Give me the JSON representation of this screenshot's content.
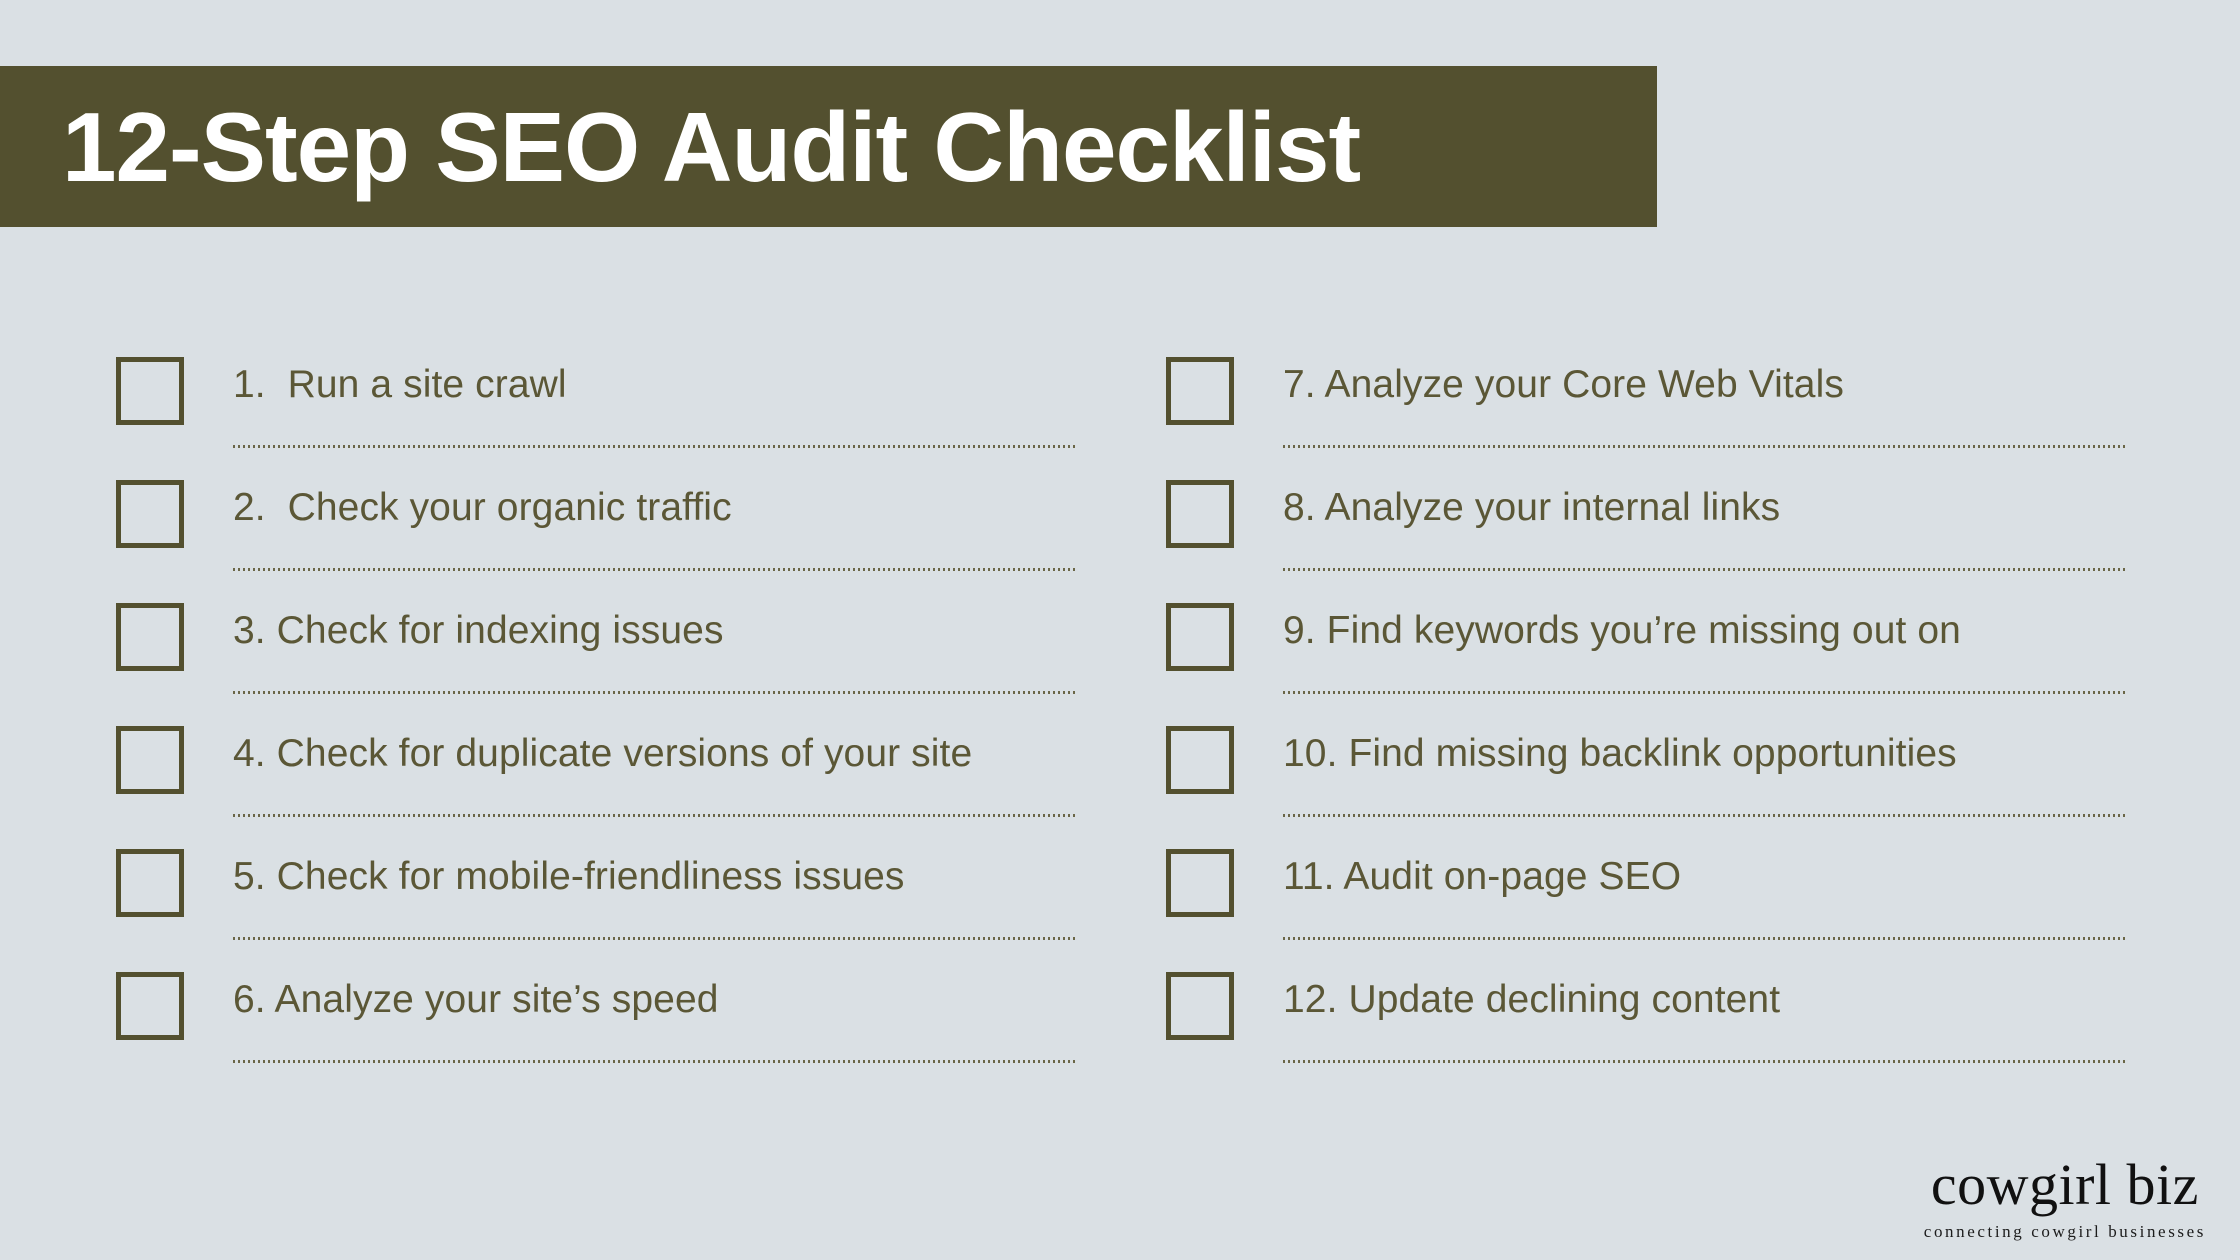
{
  "header": {
    "title": "12-Step SEO Audit Checklist",
    "band_color": "#53502f",
    "title_color": "#ffffff"
  },
  "page": {
    "background_color": "#dae0e4",
    "accent_color": "#53502f",
    "text_color": "#5b5736"
  },
  "checklist": {
    "checkbox_state": "unchecked",
    "columns": [
      {
        "name": "left-column",
        "items": [
          {
            "number": "1.",
            "label": "Run a site crawl",
            "text": "1.  Run a site crawl"
          },
          {
            "number": "2.",
            "label": "Check your organic traffic",
            "text": "2.  Check your organic traffic"
          },
          {
            "number": "3.",
            "label": "Check for indexing issues",
            "text": "3. Check for indexing issues"
          },
          {
            "number": "4.",
            "label": "Check for duplicate versions of your site",
            "text": "4. Check for duplicate versions of your site"
          },
          {
            "number": "5.",
            "label": "Check for mobile-friendliness issues",
            "text": "5. Check for mobile-friendliness issues"
          },
          {
            "number": "6.",
            "label": "Analyze your site’s speed",
            "text": "6. Analyze your site’s speed"
          }
        ]
      },
      {
        "name": "right-column",
        "items": [
          {
            "number": "7.",
            "label": "Analyze your Core Web Vitals",
            "text": "7. Analyze your Core Web Vitals"
          },
          {
            "number": "8.",
            "label": "Analyze your internal links",
            "text": "8. Analyze your internal links"
          },
          {
            "number": "9.",
            "label": "Find keywords you’re missing out on",
            "text": "9. Find keywords you’re missing out on"
          },
          {
            "number": "10.",
            "label": "Find missing backlink opportunities",
            "text": "10. Find missing backlink opportunities"
          },
          {
            "number": "11.",
            "label": "Audit on-page SEO",
            "text": "11. Audit on-page SEO"
          },
          {
            "number": "12.",
            "label": "Update declining content",
            "text": "12. Update declining content"
          }
        ]
      }
    ]
  },
  "logo": {
    "wordmark": "cowgirl biz",
    "tagline": "connecting cowgirl businesses"
  }
}
